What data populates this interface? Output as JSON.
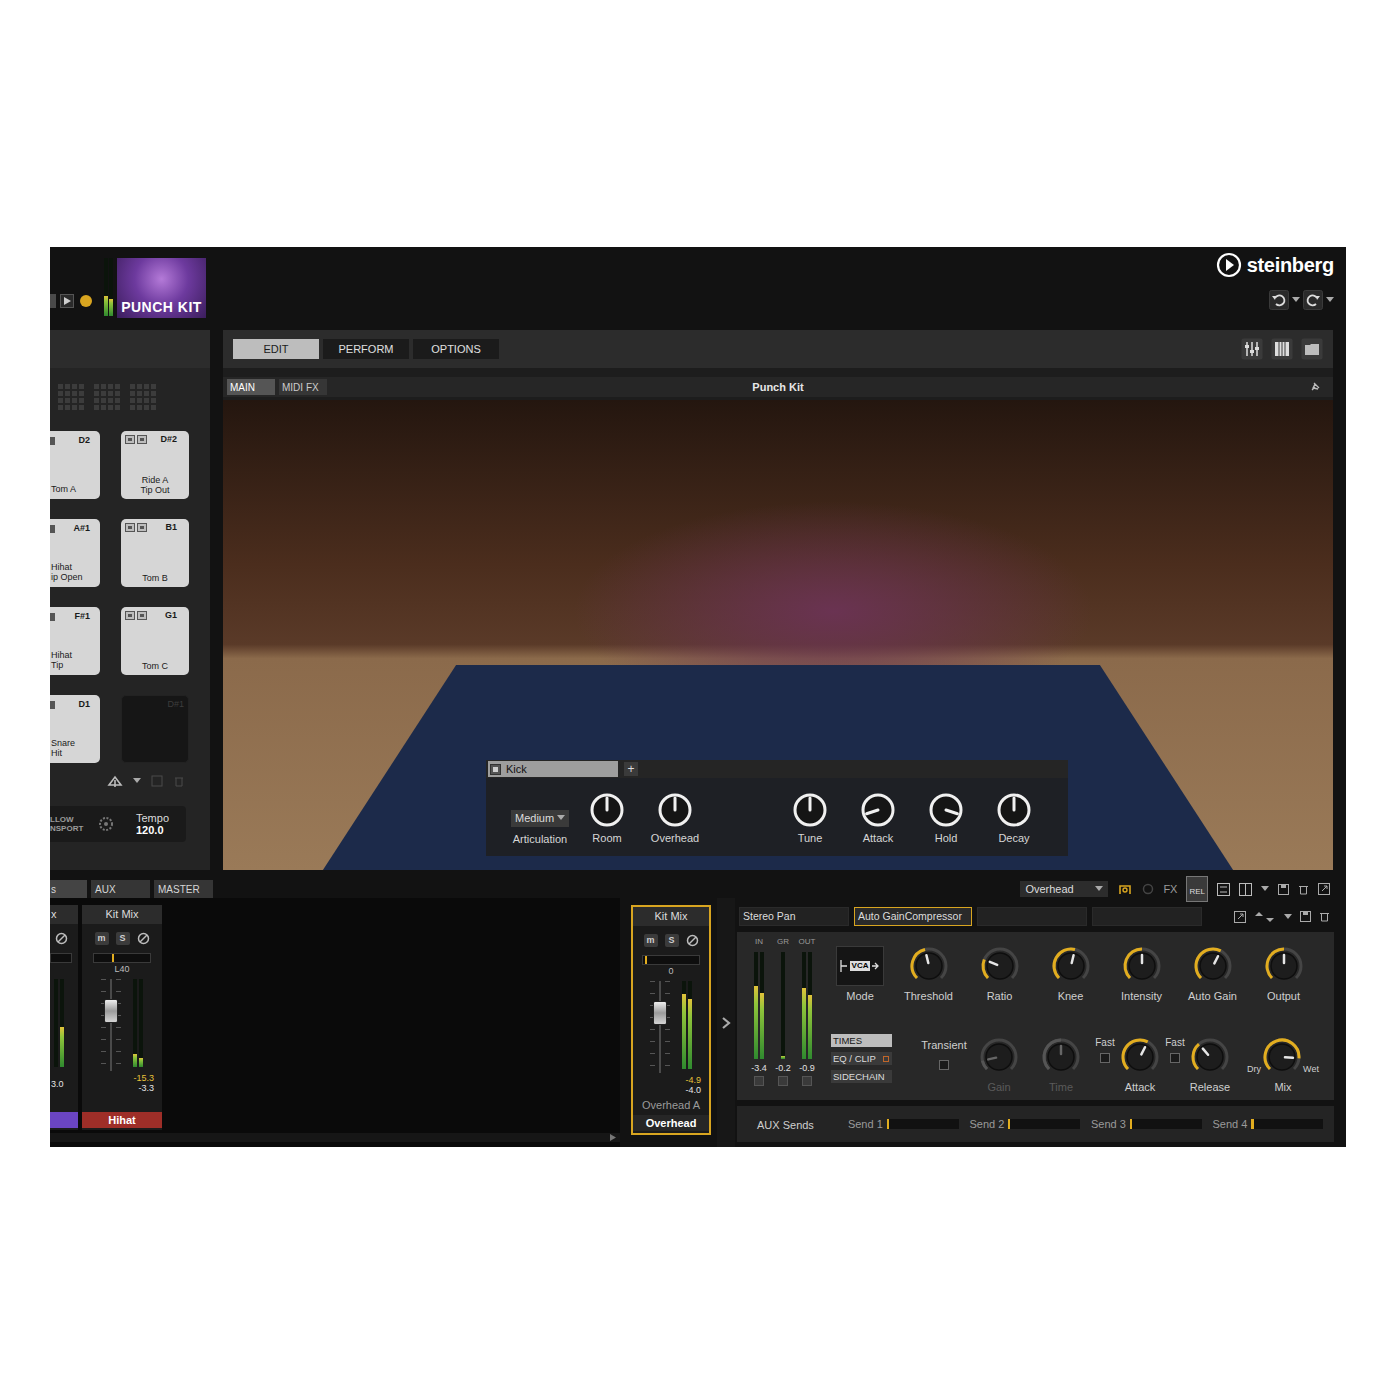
{
  "header": {
    "logo": "PUNCH KIT",
    "brand": "steinberg",
    "output_meter": [
      0.35,
      0.3
    ]
  },
  "main_tabs": [
    {
      "label": "EDIT",
      "selected": true
    },
    {
      "label": "PERFORM",
      "selected": false
    },
    {
      "label": "OPTIONS",
      "selected": false
    }
  ],
  "program": {
    "sub_tabs": [
      {
        "label": "MAIN",
        "selected": true
      },
      {
        "label": "MIDI FX",
        "selected": false
      }
    ],
    "title": "Punch Kit"
  },
  "pads": [
    {
      "note": "D2",
      "lines": [
        "Tom A"
      ],
      "kind": "cut"
    },
    {
      "note": "D#2",
      "lines": [
        "Ride A",
        "Tip Out"
      ],
      "kind": "full"
    },
    {
      "note": "A#1",
      "lines": [
        "Hihat",
        "ip Open"
      ],
      "kind": "cut"
    },
    {
      "note": "B1",
      "lines": [
        "Tom B"
      ],
      "kind": "full"
    },
    {
      "note": "F#1",
      "lines": [
        "Hihat",
        "Tip"
      ],
      "kind": "cut"
    },
    {
      "note": "G1",
      "lines": [
        "Tom C"
      ],
      "kind": "full"
    },
    {
      "note": "D1",
      "lines": [
        "Snare",
        "Hit"
      ],
      "kind": "cut"
    },
    {
      "note": "D#1",
      "lines": [],
      "kind": "empty"
    }
  ],
  "transport": {
    "follow": [
      "LLOW",
      "NSPORT"
    ],
    "tempo_label": "Tempo",
    "tempo": "120.0"
  },
  "instrument_panel": {
    "name": "Kick",
    "add": "+",
    "articulation": {
      "value": "Medium",
      "label": "Articulation"
    },
    "knobs": [
      {
        "label": "Room",
        "level": 0.5
      },
      {
        "label": "Overhead",
        "level": 0.5
      },
      {
        "label": "Tune",
        "level": 0.5
      },
      {
        "label": "Attack",
        "level": 0.1
      },
      {
        "label": "Hold",
        "level": 0.9
      },
      {
        "label": "Decay",
        "level": 0.5
      }
    ]
  },
  "mixer": {
    "tabs": [
      {
        "label": "s",
        "selected": true
      },
      {
        "label": "AUX",
        "selected": false
      },
      {
        "label": "MASTER",
        "selected": false
      }
    ],
    "output_select": "Overhead",
    "fx": "FX",
    "rel": "REL",
    "channels": [
      {
        "kind": "cut",
        "title": "x",
        "meter": [
          0.0,
          0.45
        ],
        "reading": "3.0",
        "color": "#6b45c2"
      },
      {
        "kind": "full",
        "title": "Kit Mix",
        "mute": "m",
        "muted": false,
        "solo": "S",
        "soloed": false,
        "pan_level": 0.32,
        "pan": "L40",
        "fader": 0.7,
        "meter": [
          0.15,
          0.1
        ],
        "peak": "-15.3",
        "reading": "-3.3",
        "name": "Hihat",
        "color": "#9e2e28"
      }
    ],
    "focus_channel": {
      "kind": "full",
      "title": "Kit Mix",
      "mute": "m",
      "muted": false,
      "solo": "S",
      "soloed": false,
      "pan_level": 0.03,
      "pan": "0",
      "fader": 0.7,
      "meter": [
        0.85,
        0.8
      ],
      "peak": "-4.9",
      "reading": "-4.0",
      "output": "Overhead A",
      "name": "Overhead",
      "color": "#262626",
      "selected": true
    }
  },
  "inserts": [
    {
      "label": "Stereo Pan",
      "selected": false
    },
    {
      "label": "Auto GainCompressor",
      "selected": true
    },
    {
      "label": "",
      "selected": false
    },
    {
      "label": "",
      "selected": false
    }
  ],
  "compressor": {
    "meters": [
      {
        "label": "IN",
        "levels": [
          0.68,
          0.62
        ],
        "reading": "-3.4"
      },
      {
        "label": "GR",
        "levels": [
          0.03
        ],
        "reading": "-0.2"
      },
      {
        "label": "OUT",
        "levels": [
          0.66,
          0.6
        ],
        "reading": "-0.9"
      }
    ],
    "mode": {
      "label": "Mode",
      "badge": "VCA"
    },
    "knobs": [
      {
        "label": "Threshold",
        "level": 0.45
      },
      {
        "label": "Ratio",
        "level": 0.25
      },
      {
        "label": "Knee",
        "level": 0.55
      },
      {
        "label": "Intensity",
        "level": 0.5
      },
      {
        "label": "Auto Gain",
        "level": 0.6
      },
      {
        "label": "Output",
        "level": 0.5
      }
    ],
    "pages": [
      {
        "label": "TIMES",
        "selected": true
      },
      {
        "label": "EQ / CLIP",
        "selected": false
      },
      {
        "label": "SIDECHAIN",
        "selected": false
      }
    ],
    "transient": {
      "label": "Transient",
      "checked": false
    },
    "timing": [
      {
        "kind": "knob",
        "label": "Gain",
        "level": 0.12,
        "disabled": true
      },
      {
        "kind": "knob",
        "label": "Time",
        "level": 0.5,
        "disabled": true
      },
      {
        "kind": "fast-knob",
        "fast": "Fast",
        "fast_checked": false,
        "label": "Attack",
        "level": 0.6,
        "disabled": false
      },
      {
        "kind": "fast-knob",
        "fast": "Fast",
        "fast_checked": false,
        "label": "Release",
        "level": 0.35,
        "disabled": false
      },
      {
        "kind": "mix",
        "dry": "Dry",
        "wet": "Wet",
        "label": "Mix",
        "level": 0.85,
        "disabled": false
      }
    ]
  },
  "aux_sends": {
    "title": "AUX Sends",
    "sends": [
      {
        "label": "Send 1",
        "level": 0.03
      },
      {
        "label": "Send 2",
        "level": 0.03
      },
      {
        "label": "Send 3",
        "level": 0.03
      },
      {
        "label": "Send 4",
        "level": 0.03
      }
    ]
  }
}
